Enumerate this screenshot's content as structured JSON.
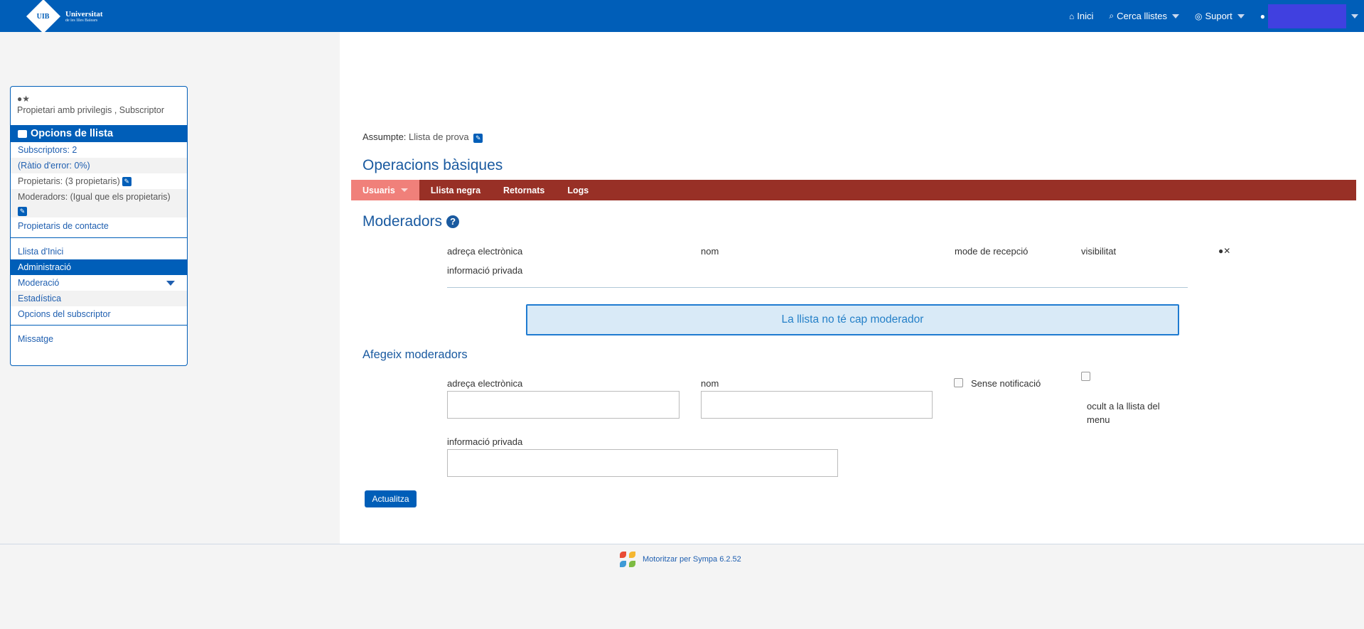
{
  "header": {
    "logo_line1": "Universitat",
    "logo_line2": "de les Illes Balears",
    "logo_mark": "UIB",
    "nav": [
      {
        "label": "Inici",
        "icon": "home-icon"
      },
      {
        "label": "Cerca llistes",
        "icon": "search-icon"
      },
      {
        "label": "Suport",
        "icon": "globe-icon"
      }
    ]
  },
  "sidebar": {
    "role": "Propietari amb privilegis , Subscriptor",
    "heading": "Opcions de llista",
    "subscribers": "Subscriptors: 2",
    "error_rate": "(Ràtio d'error: 0%)",
    "owners": "Propietaris: (3 propietaris)",
    "moderators": "Moderadors: (Igual que els propietaris)",
    "contact_owners": "Propietaris de contacte",
    "menu": [
      "Llista d'Inici",
      "Administració",
      "Moderació",
      "Estadística",
      "Opcions del subscriptor"
    ],
    "message": "Missatge"
  },
  "main": {
    "subject_label": "Assumpte:",
    "subject_value": "Llista de prova",
    "ops_title": "Operacions bàsiques",
    "tabs": [
      "Usuaris",
      "Llista negra",
      "Retornats",
      "Logs"
    ],
    "section_title": "Moderadors",
    "columns": {
      "email": "adreça electrònica",
      "name": "nom",
      "reception": "mode de recepció",
      "visibility": "visibilitat",
      "private_info": "informació privada"
    },
    "empty_message": "La llista no té cap moderador",
    "add_title": "Afegeix moderadors",
    "form": {
      "email_label": "adreça electrònica",
      "name_label": "nom",
      "no_notify_label": "Sense notificació",
      "hidden_label": "ocult a la llista del menu",
      "private_label": "informació privada",
      "submit": "Actualitza"
    }
  },
  "footer": {
    "powered": "Motoritzar per Sympa 6.2.52"
  }
}
